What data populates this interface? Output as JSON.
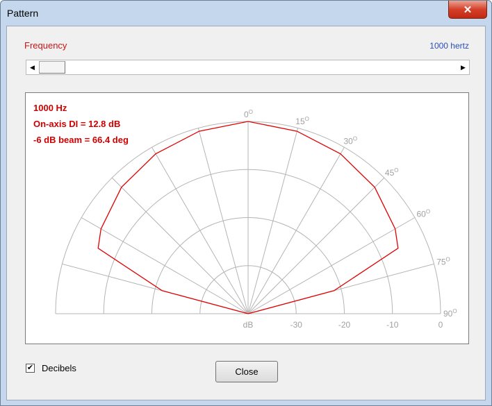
{
  "window": {
    "title": "Pattern",
    "close_glyph": "✕"
  },
  "frequency": {
    "label": "Frequency",
    "value_text": "1000 hertz",
    "slider_position": 0.0
  },
  "plot": {
    "info_lines": [
      "1000 Hz",
      "On-axis DI = 12.8 dB",
      "-6 dB beam = 66.4 deg"
    ],
    "angle_labels": [
      "0",
      "15",
      "30",
      "45",
      "60",
      "75",
      "90"
    ],
    "angle_unit": "O",
    "db_axis_labels": [
      "dB",
      "-30",
      "-20",
      "-10",
      "0"
    ],
    "colors": {
      "grid": "#b4b4b4",
      "pattern": "#e00000",
      "angle_text": "#a0a0a0"
    }
  },
  "chart_data": {
    "type": "polar",
    "title": "",
    "theta_deg": [
      0,
      15,
      30,
      45,
      60,
      66.4,
      75,
      90
    ],
    "r_db": [
      0,
      -0.7,
      -1.6,
      -2.8,
      -4.7,
      -6.0,
      -21.5,
      -40
    ],
    "r_range_db": [
      -40,
      0
    ],
    "grid": true
  },
  "controls": {
    "decibels_label": "Decibels",
    "decibels_checked": true,
    "check_glyph": "✔",
    "close_button_label": "Close"
  }
}
